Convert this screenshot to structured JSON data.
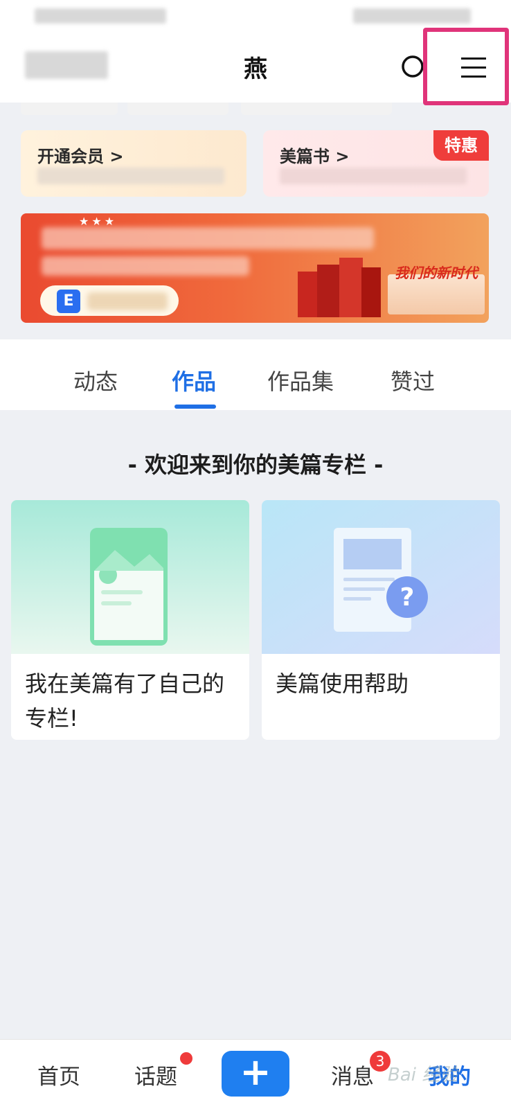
{
  "header": {
    "title": "燕"
  },
  "cards": {
    "vip": {
      "label": "开通会员 >"
    },
    "book": {
      "label": "美篇书 >",
      "badge": "特惠"
    }
  },
  "banner": {
    "slogan": "我们的新时代",
    "logo_letter": "E",
    "stars": "★★★"
  },
  "tabs": [
    {
      "label": "动态"
    },
    {
      "label": "作品"
    },
    {
      "label": "作品集"
    },
    {
      "label": "赞过"
    }
  ],
  "welcome": "- 欢迎来到你的美篇专栏 -",
  "posts": [
    {
      "title": "我在美篇有了自己的专栏!"
    },
    {
      "title": "美篇使用帮助"
    }
  ],
  "bottom_nav": {
    "home": "首页",
    "topics": "话题",
    "create": "+",
    "messages": "消息",
    "messages_count": "3",
    "mine": "我的"
  },
  "watermark": "Bai 经验"
}
